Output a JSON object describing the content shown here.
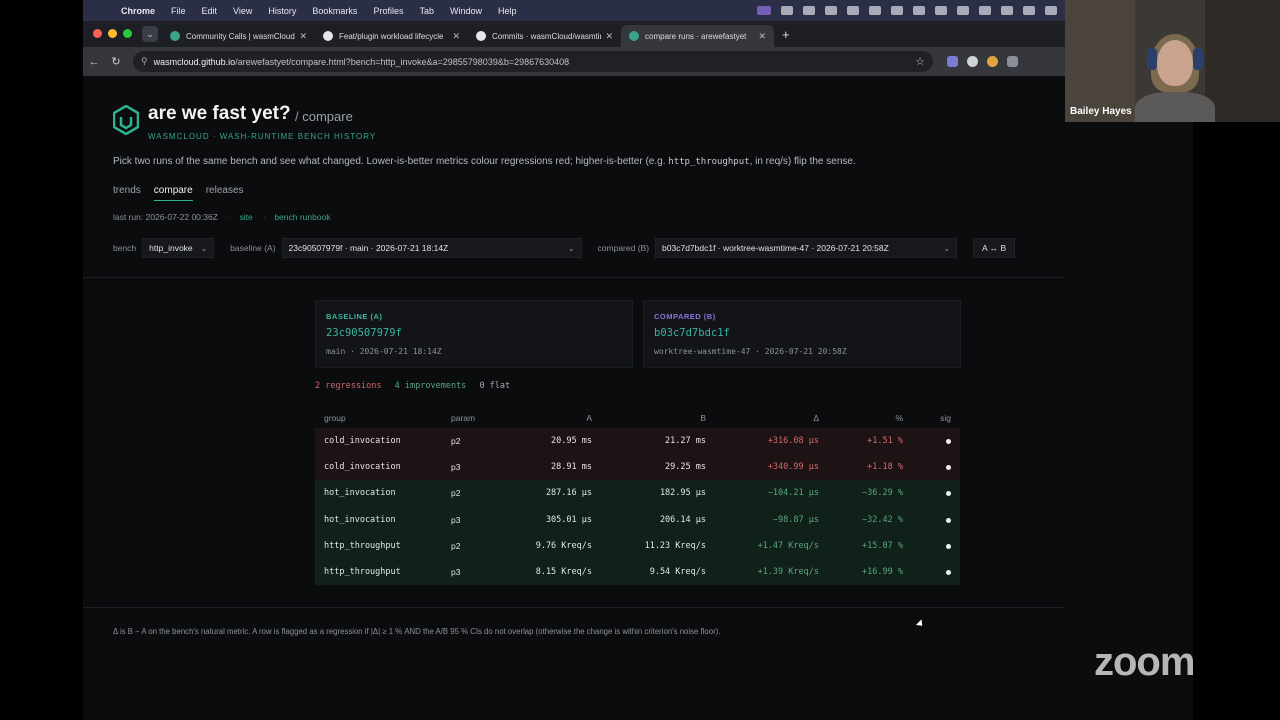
{
  "menubar": {
    "app": "Chrome",
    "items": [
      "File",
      "Edit",
      "View",
      "History",
      "Bookmarks",
      "Profiles",
      "Tab",
      "Window",
      "Help"
    ]
  },
  "tabs": [
    {
      "title": "Community Calls | wasmCloud",
      "active": false,
      "favicon_color": "#3ba389"
    },
    {
      "title": "Feat/plugin workload lifecycle",
      "active": false,
      "favicon_color": "#e6e6e6"
    },
    {
      "title": "Commits · wasmCloud/wasmtime",
      "active": false,
      "favicon_color": "#e6e6e6"
    },
    {
      "title": "compare runs · arewefastyet",
      "active": true,
      "favicon_color": "#3ba389"
    }
  ],
  "address": {
    "host": "wasmcloud.github.io",
    "path": "/arewefastyet/compare.html?bench=http_invoke&a=29855798039&b=29867630408"
  },
  "page": {
    "title": "are we fast yet?",
    "title_suffix": "/ compare",
    "brand": "WASMCLOUD · WASH-RUNTIME BENCH HISTORY",
    "intro_pre": "Pick two runs of the same bench and see what changed. Lower-is-better metrics colour regressions red; higher-is-better (e.g.",
    "intro_code": "http_throughput",
    "intro_post": ", in req/s) flip the sense.",
    "nav": [
      "trends",
      "compare",
      "releases"
    ],
    "active_nav": "compare",
    "last_run": "last run: 2026-07-22 00:36Z",
    "site_link": "site",
    "runbook_link": "bench runbook",
    "bench_label": "bench",
    "bench_value": "http_invoke",
    "baseline_label": "baseline (A)",
    "baseline_value": "23c90507979f · main · 2026-07-21 18:14Z",
    "compared_label": "compared (B)",
    "compared_value": "b03c7d7bdc1f · worktree-wasmtime-47 · 2026-07-21 20:58Z",
    "swap_label": "A ↔ B"
  },
  "cards": {
    "baseline": {
      "label": "BASELINE (A)",
      "sha": "23c90507979f",
      "meta": "main · 2026-07-21 18:14Z",
      "color": "#3bb4a0"
    },
    "compared": {
      "label": "COMPARED (B)",
      "sha": "b03c7d7bdc1f",
      "meta": "worktree-wasmtime-47 · 2026-07-21 20:58Z",
      "color": "#8b74d9"
    }
  },
  "summary": {
    "regressions": "2 regressions",
    "improvements": "4 improvements",
    "flat": "0 flat"
  },
  "table": {
    "headers": [
      "group",
      "param",
      "A",
      "B",
      "Δ",
      "%",
      "sig"
    ],
    "rows": [
      {
        "group": "cold_invocation",
        "param": "p2",
        "a": "20.95 ms",
        "b": "21.27 ms",
        "delta": "+316.08 µs",
        "pct": "+1.51 %",
        "kind": "reg"
      },
      {
        "group": "cold_invocation",
        "param": "p3",
        "a": "28.91 ms",
        "b": "29.25 ms",
        "delta": "+340.99 µs",
        "pct": "+1.18 %",
        "kind": "reg"
      },
      {
        "group": "hot_invocation",
        "param": "p2",
        "a": "287.16 µs",
        "b": "182.95 µs",
        "delta": "−104.21 µs",
        "pct": "−36.29 %",
        "kind": "imp"
      },
      {
        "group": "hot_invocation",
        "param": "p3",
        "a": "305.01 µs",
        "b": "206.14 µs",
        "delta": "−98.87 µs",
        "pct": "−32.42 %",
        "kind": "imp"
      },
      {
        "group": "http_throughput",
        "param": "p2",
        "a": "9.76 Kreq/s",
        "b": "11.23 Kreq/s",
        "delta": "+1.47 Kreq/s",
        "pct": "+15.07 %",
        "kind": "imp"
      },
      {
        "group": "http_throughput",
        "param": "p3",
        "a": "8.15 Kreq/s",
        "b": "9.54 Kreq/s",
        "delta": "+1.39 Kreq/s",
        "pct": "+16.99 %",
        "kind": "imp"
      }
    ]
  },
  "footnote": "Δ is B − A on the bench's natural metric. A row is flagged as a regression if |Δ| ≥ 1 % AND the A/B 95 % CIs do not overlap (otherwise the change is within criterion's noise floor).",
  "zoom": {
    "participant": "Bailey Hayes",
    "logo": "zoom"
  }
}
